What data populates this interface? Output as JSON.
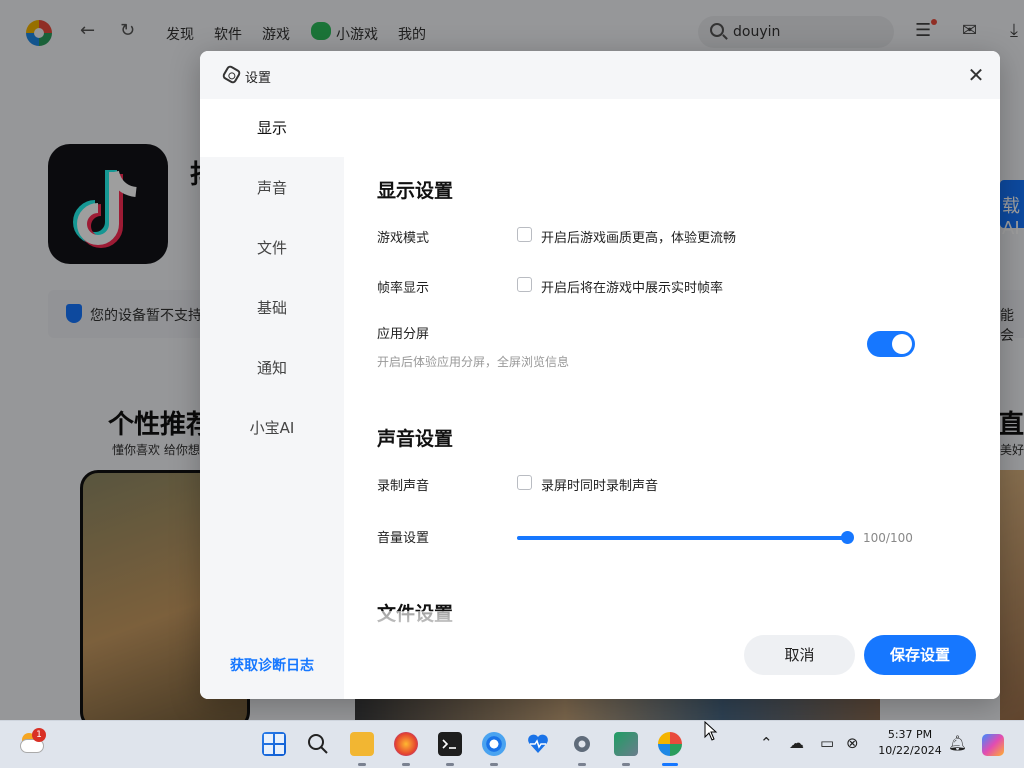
{
  "app_bar": {
    "nav": [
      "发现",
      "软件",
      "游戏",
      "小游戏",
      "我的"
    ],
    "search_value": "douyin"
  },
  "background": {
    "app_title_fragment": "抖",
    "action_fragment": "载AI",
    "notice_text": "您的设备暂不支持",
    "notice_right": "能会",
    "promo_title": "个性推荐",
    "promo_sub": "懂你喜欢 给你想",
    "promo_right_title": "直",
    "promo_right_sub": "美好"
  },
  "dialog": {
    "title": "设置",
    "close_glyph": "✕",
    "sidebar": {
      "items": [
        "显示",
        "声音",
        "文件",
        "基础",
        "通知",
        "小宝AI"
      ],
      "active": "显示",
      "diag_log": "获取诊断日志"
    },
    "display": {
      "title": "显示设置",
      "game_mode": {
        "label": "游戏模式",
        "option": "开启后游戏画质更高，体验更流畅",
        "checked": false
      },
      "fps": {
        "label": "帧率显示",
        "option": "开启后将在游戏中展示实时帧率",
        "checked": false
      },
      "split": {
        "label": "应用分屏",
        "desc": "开启后体验应用分屏，全屏浏览信息",
        "enabled": true
      }
    },
    "sound": {
      "title": "声音设置",
      "record": {
        "label": "录制声音",
        "option": "录屏时同时录制声音",
        "checked": false
      },
      "volume": {
        "label": "音量设置",
        "value": 100,
        "max": 100,
        "display": "100/100"
      }
    },
    "file": {
      "title": "文件设置"
    },
    "buttons": {
      "cancel": "取消",
      "save": "保存设置"
    }
  },
  "taskbar": {
    "weather_badge": "1",
    "time": "5:37 PM",
    "date": "10/22/2024"
  },
  "colors": {
    "accent": "#1677ff",
    "dialog_bg": "#ffffff",
    "sidebar_bg": "#f5f6f8"
  }
}
